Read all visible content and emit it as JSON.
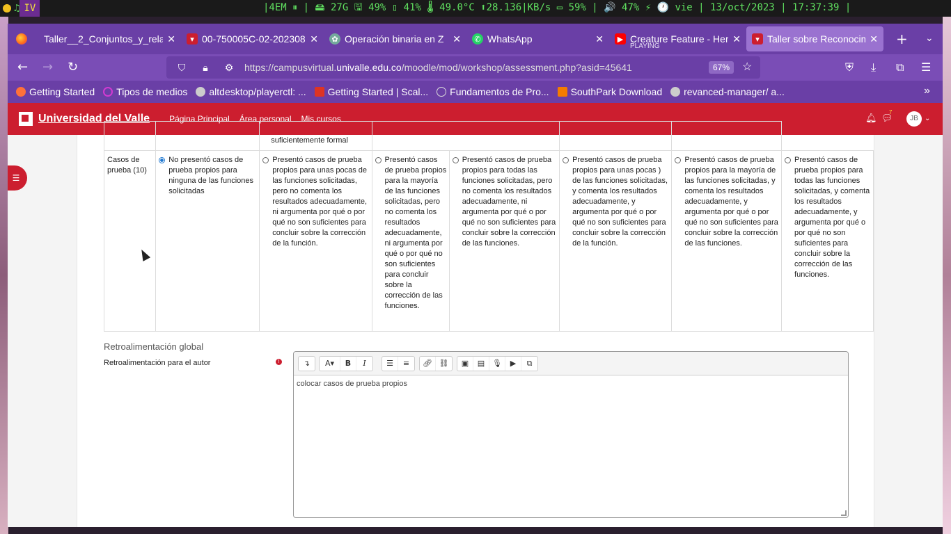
{
  "system_bar": {
    "workspace": "IV",
    "stats": "|4EM ⏸ | 🖴 27G 🖫 49% ▯ 41% 🌡 49.0°C ⬆28.136|KB/s ▭ 59% | 🔊 47% ⚡ 🕐 vie | 13/oct/2023 | 17:37:39 |"
  },
  "tabs": [
    {
      "title": "Taller__2_Conjuntos_y_rela",
      "icon": "document-icon",
      "color": "#d0d0d0"
    },
    {
      "title": "00-750005C-02-202308",
      "icon": "univalle-icon",
      "color": "#cc1e2f"
    },
    {
      "title": "Operación binaria en Z",
      "icon": "chatgpt-icon",
      "color": "#74aa9c"
    },
    {
      "title": "WhatsApp",
      "icon": "whatsapp-icon",
      "color": "#25d366"
    },
    {
      "title": "Creature Feature - Here",
      "subtitle": "PLAYING",
      "icon": "youtube-icon",
      "color": "#ff0000"
    },
    {
      "title": "Taller sobre Reconocim",
      "icon": "univalle-icon",
      "color": "#cc1e2f"
    }
  ],
  "url": {
    "prefix": "https://campusvirtual.",
    "domain": "univalle.edu.co",
    "path": "/moodle/mod/workshop/assessment.php?asid=45641",
    "zoom": "67%"
  },
  "bookmarks": [
    {
      "label": "Getting Started",
      "color": "#ff7139"
    },
    {
      "label": "Tipos de medios",
      "color": "#d23ad2"
    },
    {
      "label": "altdesktop/playerctl: ...",
      "color": "#cccccc"
    },
    {
      "label": "Getting Started | Scal...",
      "color": "#de3423"
    },
    {
      "label": "Fundamentos de Pro...",
      "color": "#cccccc"
    },
    {
      "label": "SouthPark Download",
      "color": "#f57c00"
    },
    {
      "label": "revanced-manager/ a...",
      "color": "#cccccc"
    }
  ],
  "moodle": {
    "site_name": "Universidad del Valle",
    "nav": [
      "Página Principal",
      "Área personal",
      "Mis cursos"
    ],
    "avatar": "JB",
    "notif_count": "7"
  },
  "rubric": {
    "prev_row_text": "suficientemente formal",
    "criterion": "Casos de prueba (10)",
    "levels": [
      {
        "text": "No presentó casos de prueba propios para ninguna de las funciones solicitadas",
        "selected": true
      },
      {
        "text": "Presentó casos de prueba propios para unas pocas de las funciones solicitadas, pero no comenta los resultados adecuadamente, ni argumenta por qué o por qué no son suficientes para concluir sobre la corrección de la función.",
        "selected": false
      },
      {
        "text": "Presentó casos de prueba propios para la mayoría de las funciones solicitadas, pero no comenta los resultados adecuadamente, ni argumenta por qué o por qué no son suficientes para concluir sobre la corrección de las funciones.",
        "selected": false
      },
      {
        "text": "Presentó casos de prueba propios para todas las funciones solicitadas, pero no comenta los resultados adecuadamente, ni argumenta por qué o por qué no son suficientes para concluir sobre la corrección de las funciones.",
        "selected": false
      },
      {
        "text": "Presentó casos de prueba propios para unas pocas ) de las funciones solicitadas, y comenta los resultados adecuadamente, y argumenta por qué o por qué no son suficientes para concluir sobre la corrección de la función.",
        "selected": false
      },
      {
        "text": "Presentó casos de prueba propios para la mayoría de las funciones solicitadas, y comenta los resultados adecuadamente, y argumenta por qué o por qué no son suficientes para concluir sobre la corrección de las funciones.",
        "selected": false
      },
      {
        "text": "Presentó casos de prueba propios para todas las funciones solicitadas, y comenta los resultados adecuadamente, y argumenta por qué o por qué no son suficientes para concluir sobre la corrección de las funciones.",
        "selected": false
      }
    ]
  },
  "feedback": {
    "section_title": "Retroalimentación global",
    "label": "Retroalimentación para el autor",
    "editor_text": "colocar casos de prueba propios"
  },
  "colors": {
    "brand_red": "#cc1e2f",
    "browser_purple": "#6a3fa6",
    "radio_selected": "#1f78d1"
  }
}
